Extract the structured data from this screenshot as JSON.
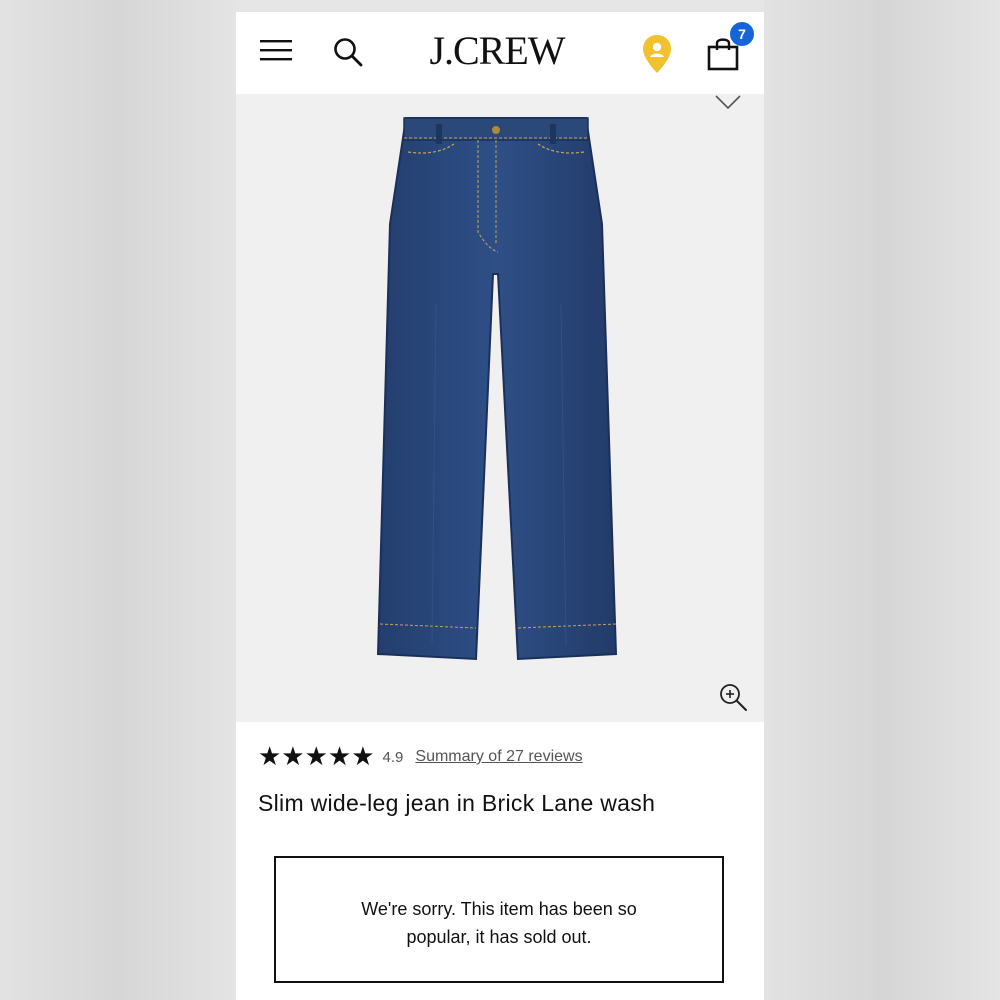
{
  "header": {
    "logo": "J.CREW",
    "bag_count": "7",
    "icons": {
      "menu": "hamburger-menu-icon",
      "search": "search-icon",
      "location": "location-pin-icon",
      "bag": "shopping-bag-icon"
    },
    "location_color": "#f2c12e",
    "badge_color": "#1565d8"
  },
  "product": {
    "image_alt": "Slim wide-leg jean in Brick Lane wash",
    "stars": "★★★★★",
    "rating": "4.9",
    "reviews_link": "Summary of 27 reviews",
    "title": "Slim wide-leg jean in Brick Lane wash",
    "icons": {
      "wishlist": "heart-icon",
      "zoom": "zoom-in-icon"
    }
  },
  "notice": {
    "sold_out_message": "We're sorry. This item has been so popular, it has sold out."
  }
}
